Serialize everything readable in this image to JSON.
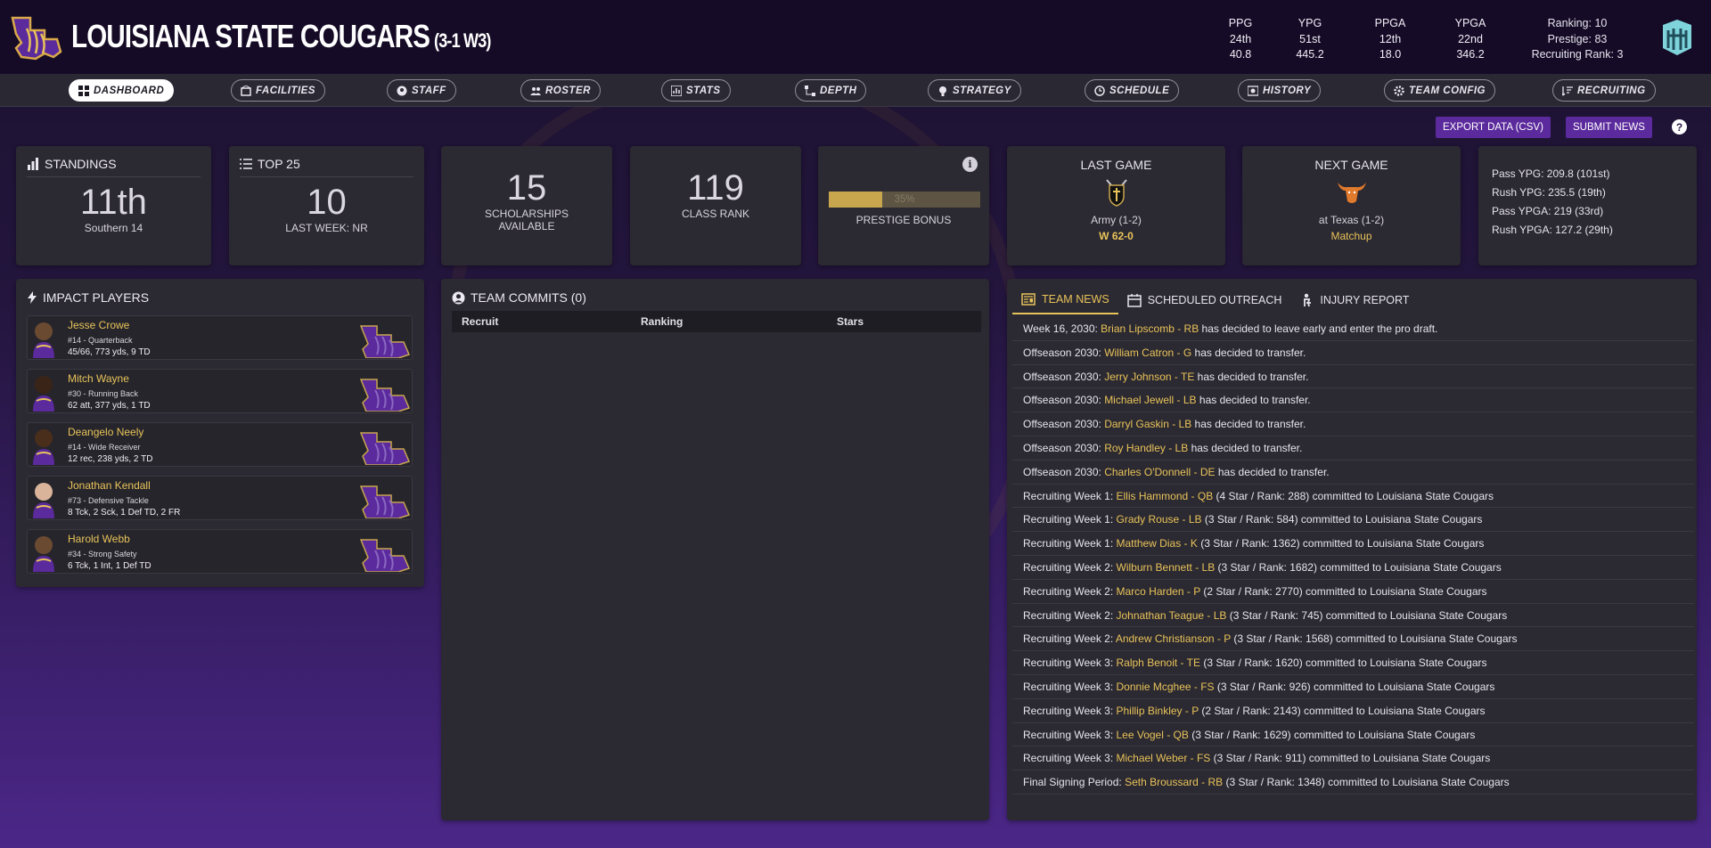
{
  "header": {
    "team_name": "LOUISIANA STATE COUGARS",
    "record": "(3-1 W3)",
    "stats": [
      {
        "label": "PPG",
        "rank": "24th",
        "value": "40.8"
      },
      {
        "label": "YPG",
        "rank": "51st",
        "value": "445.2"
      },
      {
        "label": "PPGA",
        "rank": "12th",
        "value": "18.0"
      },
      {
        "label": "YPGA",
        "rank": "22nd",
        "value": "346.2"
      }
    ],
    "ranking": "Ranking: 10",
    "prestige": "Prestige: 83",
    "recruiting_rank": "Recruiting Rank: 3"
  },
  "nav": [
    {
      "label": "DASHBOARD",
      "icon": "dashboard-icon",
      "active": true
    },
    {
      "label": "FACILITIES",
      "icon": "facilities-icon"
    },
    {
      "label": "STAFF",
      "icon": "staff-icon"
    },
    {
      "label": "ROSTER",
      "icon": "roster-icon"
    },
    {
      "label": "STATS",
      "icon": "stats-icon"
    },
    {
      "label": "DEPTH",
      "icon": "depth-icon"
    },
    {
      "label": "STRATEGY",
      "icon": "strategy-icon"
    },
    {
      "label": "SCHEDULE",
      "icon": "clock-icon"
    },
    {
      "label": "HISTORY",
      "icon": "history-icon"
    },
    {
      "label": "TEAM CONFIG",
      "icon": "gear-icon"
    },
    {
      "label": "RECRUITING",
      "icon": "recruiting-icon"
    }
  ],
  "actions": {
    "export": "EXPORT DATA (CSV)",
    "submit": "SUBMIT NEWS",
    "help": "?"
  },
  "standings": {
    "title": "STANDINGS",
    "value": "11th",
    "sub": "Southern 14"
  },
  "top25": {
    "title": "TOP 25",
    "value": "10",
    "sub": "LAST WEEK: NR"
  },
  "scholarships": {
    "value": "15",
    "sub1": "SCHOLARSHIPS",
    "sub2": "AVAILABLE"
  },
  "class_rank": {
    "value": "119",
    "sub": "CLASS RANK"
  },
  "prestige_bonus": {
    "percent": 35,
    "percent_label": "35%",
    "sub": "PRESTIGE BONUS"
  },
  "last_game": {
    "title": "LAST GAME",
    "opponent": "Army (1-2)",
    "result": "W 62-0"
  },
  "next_game": {
    "title": "NEXT GAME",
    "opponent": "at Texas (1-2)",
    "link": "Matchup"
  },
  "side_stats": [
    "Pass YPG: 209.8 (101st)",
    "Rush YPG: 235.5 (19th)",
    "Pass YPGA: 219 (33rd)",
    "Rush YPGA: 127.2 (29th)"
  ],
  "impact_players": {
    "title": "IMPACT PLAYERS",
    "players": [
      {
        "name": "Jesse Crowe",
        "pos": "#14 - Quarterback",
        "stats": "45/66, 773 yds, 9 TD"
      },
      {
        "name": "Mitch Wayne",
        "pos": "#30 - Running Back",
        "stats": "62 att, 377 yds, 1 TD"
      },
      {
        "name": "Deangelo Neely",
        "pos": "#14 - Wide Receiver",
        "stats": "12 rec, 238 yds, 2 TD"
      },
      {
        "name": "Jonathan Kendall",
        "pos": "#73 - Defensive Tackle",
        "stats": "8 Tck, 2 Sck, 1 Def TD, 2 FR"
      },
      {
        "name": "Harold Webb",
        "pos": "#34 - Strong Safety",
        "stats": "6 Tck, 1 Int, 1 Def TD"
      }
    ]
  },
  "commits": {
    "title": "TEAM COMMITS (0)",
    "columns": [
      "Recruit",
      "Ranking",
      "Stars"
    ]
  },
  "news": {
    "tabs": [
      "TEAM NEWS",
      "SCHEDULED OUTREACH",
      "INJURY REPORT"
    ],
    "rows": [
      {
        "pre": "Week 16, 2030: ",
        "link": "Brian Lipscomb - RB",
        "post": " has decided to leave early and enter the pro draft."
      },
      {
        "pre": "Offseason 2030: ",
        "link": "William Catron - G",
        "post": " has decided to transfer."
      },
      {
        "pre": "Offseason 2030: ",
        "link": "Jerry Johnson - TE",
        "post": " has decided to transfer."
      },
      {
        "pre": "Offseason 2030: ",
        "link": "Michael Jewell - LB",
        "post": " has decided to transfer."
      },
      {
        "pre": "Offseason 2030: ",
        "link": "Darryl Gaskin - LB",
        "post": " has decided to transfer."
      },
      {
        "pre": "Offseason 2030: ",
        "link": "Roy Handley - LB",
        "post": " has decided to transfer."
      },
      {
        "pre": "Offseason 2030: ",
        "link": "Charles O'Donnell - DE",
        "post": " has decided to transfer."
      },
      {
        "pre": "Recruiting Week 1: ",
        "link": "Ellis Hammond - QB",
        "post": " (4 Star / Rank: 288) committed to Louisiana State Cougars"
      },
      {
        "pre": "Recruiting Week 1: ",
        "link": "Grady Rouse - LB",
        "post": " (3 Star / Rank: 584) committed to Louisiana State Cougars"
      },
      {
        "pre": "Recruiting Week 1: ",
        "link": "Matthew Dias - K",
        "post": " (3 Star / Rank: 1362) committed to Louisiana State Cougars"
      },
      {
        "pre": "Recruiting Week 2: ",
        "link": "Wilburn Bennett - LB",
        "post": " (3 Star / Rank: 1682) committed to Louisiana State Cougars"
      },
      {
        "pre": "Recruiting Week 2: ",
        "link": "Marco Harden - P",
        "post": " (2 Star / Rank: 2770) committed to Louisiana State Cougars"
      },
      {
        "pre": "Recruiting Week 2: ",
        "link": "Johnathan Teague - LB",
        "post": " (3 Star / Rank: 745) committed to Louisiana State Cougars"
      },
      {
        "pre": "Recruiting Week 2: ",
        "link": "Andrew Christianson - P",
        "post": " (3 Star / Rank: 1568) committed to Louisiana State Cougars"
      },
      {
        "pre": "Recruiting Week 3: ",
        "link": "Ralph Benoit - TE",
        "post": " (3 Star / Rank: 1620) committed to Louisiana State Cougars"
      },
      {
        "pre": "Recruiting Week 3: ",
        "link": "Donnie Mcghee - FS",
        "post": " (3 Star / Rank: 926) committed to Louisiana State Cougars"
      },
      {
        "pre": "Recruiting Week 3: ",
        "link": "Phillip Binkley - P",
        "post": " (2 Star / Rank: 2143) committed to Louisiana State Cougars"
      },
      {
        "pre": "Recruiting Week 3: ",
        "link": "Lee Vogel - QB",
        "post": " (3 Star / Rank: 1629) committed to Louisiana State Cougars"
      },
      {
        "pre": "Recruiting Week 3: ",
        "link": "Michael Weber - FS",
        "post": " (3 Star / Rank: 911) committed to Louisiana State Cougars"
      },
      {
        "pre": "Final Signing Period: ",
        "link": "Seth Broussard - RB",
        "post": " (3 Star / Rank: 1348) committed to Louisiana State Cougars"
      }
    ]
  },
  "colors": {
    "accent": "#e8c35a",
    "brand_purple": "#5b2a9c",
    "card": "#2b2931"
  }
}
